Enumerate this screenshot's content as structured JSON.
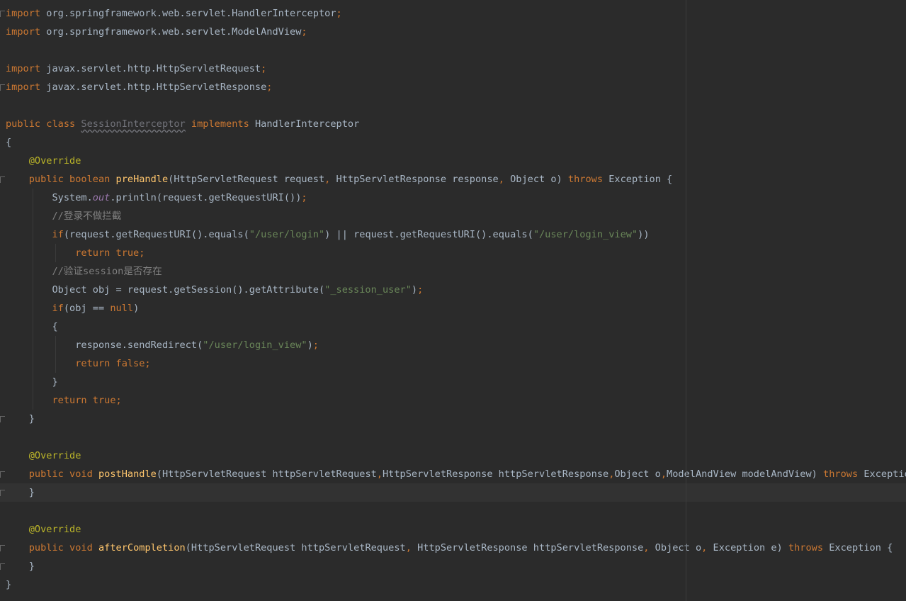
{
  "editor": {
    "colors": {
      "background": "#2b2b2b",
      "current_line": "#323232",
      "keyword": "#cc7832",
      "identifier": "#a9b7c6",
      "string": "#6a8759",
      "comment": "#808080",
      "annotation": "#bbb529",
      "method_declaration": "#ffc66d",
      "static_field": "#9876aa",
      "unused": "#72737a"
    },
    "lines": [
      {
        "indent": "",
        "tokens": [
          {
            "c": "kw",
            "t": "import"
          },
          {
            "c": "id",
            "t": " org.springframework.web.servlet.HandlerInterceptor"
          },
          {
            "c": "kw",
            "t": ";"
          }
        ]
      },
      {
        "indent": "",
        "tokens": [
          {
            "c": "kw",
            "t": "import"
          },
          {
            "c": "id",
            "t": " org.springframework.web.servlet.ModelAndView"
          },
          {
            "c": "kw",
            "t": ";"
          }
        ]
      },
      {
        "indent": "",
        "tokens": []
      },
      {
        "indent": "",
        "tokens": [
          {
            "c": "kw",
            "t": "import"
          },
          {
            "c": "id",
            "t": " javax.servlet.http.HttpServletRequest"
          },
          {
            "c": "kw",
            "t": ";"
          }
        ]
      },
      {
        "indent": "",
        "tokens": [
          {
            "c": "kw",
            "t": "import"
          },
          {
            "c": "id",
            "t": " javax.servlet.http.HttpServletResponse"
          },
          {
            "c": "kw",
            "t": ";"
          }
        ]
      },
      {
        "indent": "",
        "tokens": []
      },
      {
        "indent": "",
        "tokens": [
          {
            "c": "kw",
            "t": "public class "
          },
          {
            "c": "un",
            "t": "SessionInterceptor"
          },
          {
            "c": "kw",
            "t": " implements "
          },
          {
            "c": "id",
            "t": "HandlerInterceptor"
          }
        ]
      },
      {
        "indent": "",
        "tokens": [
          {
            "c": "id",
            "t": "{"
          }
        ]
      },
      {
        "indent": "    ",
        "tokens": [
          {
            "c": "ann",
            "t": "@Override"
          }
        ]
      },
      {
        "indent": "    ",
        "tokens": [
          {
            "c": "kw",
            "t": "public boolean "
          },
          {
            "c": "fn",
            "t": "preHandle"
          },
          {
            "c": "id",
            "t": "(HttpServletRequest request"
          },
          {
            "c": "kw",
            "t": ", "
          },
          {
            "c": "id",
            "t": "HttpServletResponse response"
          },
          {
            "c": "kw",
            "t": ", "
          },
          {
            "c": "id",
            "t": "Object o) "
          },
          {
            "c": "kw",
            "t": "throws "
          },
          {
            "c": "id",
            "t": "Exception {"
          }
        ]
      },
      {
        "indent": "        ",
        "tokens": [
          {
            "c": "id",
            "t": "System."
          },
          {
            "c": "fld",
            "t": "out"
          },
          {
            "c": "id",
            "t": ".println(request.getRequestURI())"
          },
          {
            "c": "kw",
            "t": ";"
          }
        ]
      },
      {
        "indent": "        ",
        "tokens": [
          {
            "c": "cm",
            "t": "//"
          },
          {
            "c": "cm cjk",
            "t": "登录不做拦截"
          }
        ]
      },
      {
        "indent": "        ",
        "tokens": [
          {
            "c": "kw",
            "t": "if"
          },
          {
            "c": "id",
            "t": "(request.getRequestURI().equals("
          },
          {
            "c": "str",
            "t": "\"/user/login\""
          },
          {
            "c": "id",
            "t": ") || request.getRequestURI().equals("
          },
          {
            "c": "str",
            "t": "\"/user/login_view\""
          },
          {
            "c": "id",
            "t": "))"
          }
        ]
      },
      {
        "indent": "            ",
        "tokens": [
          {
            "c": "kw",
            "t": "return true;"
          }
        ]
      },
      {
        "indent": "        ",
        "tokens": [
          {
            "c": "cm",
            "t": "//"
          },
          {
            "c": "cm cjk",
            "t": "验证"
          },
          {
            "c": "cm",
            "t": "session"
          },
          {
            "c": "cm cjk",
            "t": "是否存在"
          }
        ]
      },
      {
        "indent": "        ",
        "tokens": [
          {
            "c": "id",
            "t": "Object obj = request.getSession().getAttribute("
          },
          {
            "c": "str",
            "t": "\"_session_user\""
          },
          {
            "c": "id",
            "t": ")"
          },
          {
            "c": "kw",
            "t": ";"
          }
        ]
      },
      {
        "indent": "        ",
        "tokens": [
          {
            "c": "kw",
            "t": "if"
          },
          {
            "c": "id",
            "t": "(obj == "
          },
          {
            "c": "kw",
            "t": "null"
          },
          {
            "c": "id",
            "t": ")"
          }
        ]
      },
      {
        "indent": "        ",
        "tokens": [
          {
            "c": "id",
            "t": "{"
          }
        ]
      },
      {
        "indent": "            ",
        "tokens": [
          {
            "c": "id",
            "t": "response.sendRedirect("
          },
          {
            "c": "str",
            "t": "\"/user/login_view\""
          },
          {
            "c": "id",
            "t": ")"
          },
          {
            "c": "kw",
            "t": ";"
          }
        ]
      },
      {
        "indent": "            ",
        "tokens": [
          {
            "c": "kw",
            "t": "return false;"
          }
        ]
      },
      {
        "indent": "        ",
        "tokens": [
          {
            "c": "id",
            "t": "}"
          }
        ]
      },
      {
        "indent": "        ",
        "tokens": [
          {
            "c": "kw",
            "t": "return true;"
          }
        ]
      },
      {
        "indent": "    ",
        "tokens": [
          {
            "c": "id",
            "t": "}"
          }
        ]
      },
      {
        "indent": "",
        "tokens": []
      },
      {
        "indent": "    ",
        "tokens": [
          {
            "c": "ann",
            "t": "@Override"
          }
        ]
      },
      {
        "indent": "    ",
        "tokens": [
          {
            "c": "kw",
            "t": "public void "
          },
          {
            "c": "fn",
            "t": "postHandle"
          },
          {
            "c": "id",
            "t": "(HttpServletRequest httpServletRequest"
          },
          {
            "c": "kw",
            "t": ","
          },
          {
            "c": "id",
            "t": "HttpServletResponse httpServletResponse"
          },
          {
            "c": "kw",
            "t": ","
          },
          {
            "c": "id",
            "t": "Object o"
          },
          {
            "c": "kw",
            "t": ","
          },
          {
            "c": "id",
            "t": "ModelAndView modelAndView) "
          },
          {
            "c": "kw",
            "t": "throws "
          },
          {
            "c": "id",
            "t": "Exception {"
          }
        ]
      },
      {
        "indent": "    ",
        "tokens": [
          {
            "c": "id",
            "t": "}"
          }
        ]
      },
      {
        "indent": "",
        "tokens": []
      },
      {
        "indent": "    ",
        "tokens": [
          {
            "c": "ann",
            "t": "@Override"
          }
        ]
      },
      {
        "indent": "    ",
        "tokens": [
          {
            "c": "kw",
            "t": "public void "
          },
          {
            "c": "fn",
            "t": "afterCompletion"
          },
          {
            "c": "id",
            "t": "(HttpServletRequest httpServletRequest"
          },
          {
            "c": "kw",
            "t": ", "
          },
          {
            "c": "id",
            "t": "HttpServletResponse httpServletResponse"
          },
          {
            "c": "kw",
            "t": ", "
          },
          {
            "c": "id",
            "t": "Object o"
          },
          {
            "c": "kw",
            "t": ", "
          },
          {
            "c": "id",
            "t": "Exception e) "
          },
          {
            "c": "kw",
            "t": "throws "
          },
          {
            "c": "id",
            "t": "Exception {"
          }
        ]
      },
      {
        "indent": "    ",
        "tokens": [
          {
            "c": "id",
            "t": "}"
          }
        ]
      },
      {
        "indent": "",
        "tokens": [
          {
            "c": "id",
            "t": "}"
          }
        ]
      }
    ]
  }
}
